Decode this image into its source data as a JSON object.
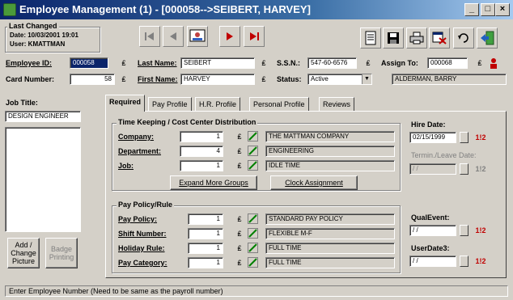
{
  "window": {
    "title": "Employee Management (1) - [000058-->SEIBERT, HARVEY]"
  },
  "last_changed": {
    "legend": "Last Changed",
    "date_line": "Date: 10/03/2001 19:01",
    "user_line": "User: KMATTMAN"
  },
  "header": {
    "employee_id_label": "Employee ID:",
    "employee_id": "000058",
    "card_number_label": "Card Number:",
    "card_number": "58",
    "last_name_label": "Last Name:",
    "last_name": "SEIBERT",
    "first_name_label": "First Name:",
    "first_name": "HARVEY",
    "ssn_label": "S.S.N.:",
    "ssn": "547-60-6576",
    "status_label": "Status:",
    "status": "Active",
    "assign_to_label": "Assign To:",
    "assign_to": "000068",
    "assign_to_name": "ALDERMAN, BARRY"
  },
  "left_panel": {
    "job_title_label": "Job Title:",
    "job_title": "DESIGN ENGINEER",
    "add_change_picture": "Add / Change Picture",
    "badge_printing": "Badge Printing"
  },
  "tabs": [
    {
      "label": "Required"
    },
    {
      "label": "Pay Profile"
    },
    {
      "label": "H.R. Profile"
    },
    {
      "label": "Personal Profile"
    },
    {
      "label": "Reviews"
    }
  ],
  "timekeeping": {
    "legend": "Time Keeping / Cost Center Distribution",
    "rows": [
      {
        "label": "Company:",
        "value": "1",
        "desc": "THE MATTMAN COMPANY"
      },
      {
        "label": "Department:",
        "value": "4",
        "desc": "ENGINEERING"
      },
      {
        "label": "Job:",
        "value": "1",
        "desc": "IDLE TIME"
      }
    ],
    "expand_button": "Expand More Groups",
    "clock_button": "Clock Assignment"
  },
  "pay_policy": {
    "legend": "Pay Policy/Rule",
    "rows": [
      {
        "label": "Pay Policy:",
        "value": "1",
        "desc": "STANDARD PAY POLICY"
      },
      {
        "label": "Shift Number:",
        "value": "1",
        "desc": "FLEXIBLE M-F"
      },
      {
        "label": "Holiday Rule:",
        "value": "1",
        "desc": "FULL TIME"
      },
      {
        "label": "Pay Category:",
        "value": "1",
        "desc": "FULL TIME"
      }
    ]
  },
  "dates": {
    "hire_label": "Hire Date:",
    "hire_value": "02/15/1999",
    "term_label": "Termin./Leave Date:",
    "term_value": "/ /",
    "qual_label": "QualEvent:",
    "qual_value": "/ /",
    "user3_label": "UserDate3:",
    "user3_value": "/ /"
  },
  "status_bar": {
    "text": "Enter Employee Number (Need to be same as the payroll number)"
  }
}
